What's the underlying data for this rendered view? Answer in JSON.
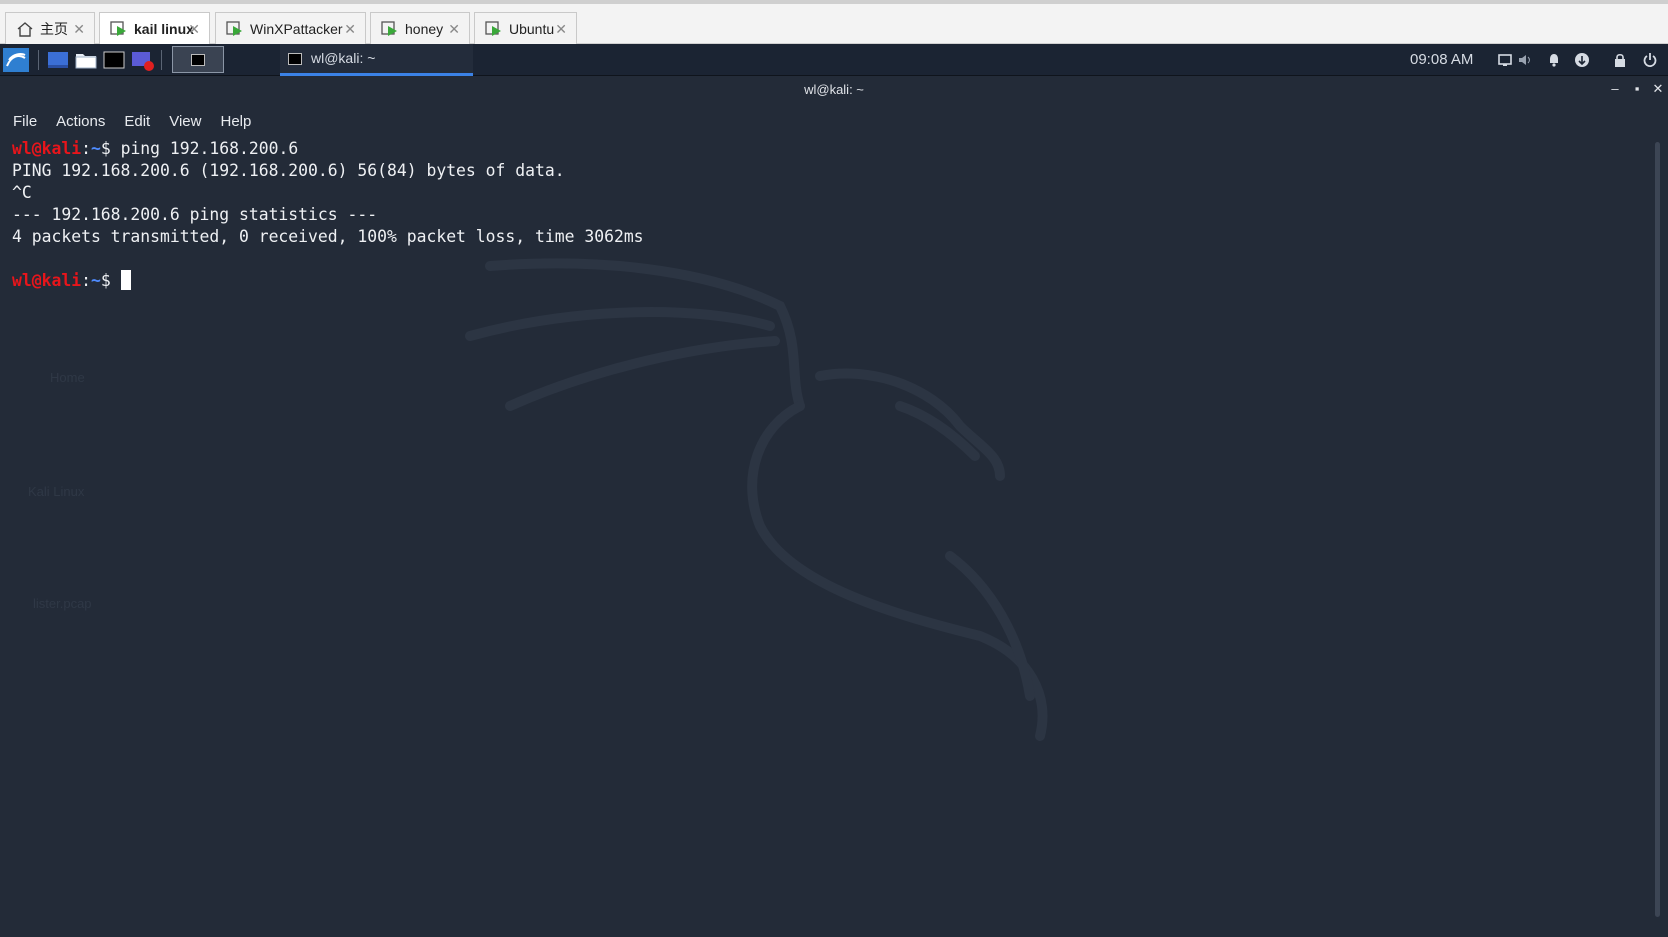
{
  "vm_tabs": [
    {
      "label": "主页",
      "icon": "home-icon",
      "active": false
    },
    {
      "label": "kail linux",
      "icon": "vm-play-icon",
      "active": true
    },
    {
      "label": "WinXPattacker",
      "icon": "vm-play-icon",
      "active": false
    },
    {
      "label": "honey",
      "icon": "vm-play-icon",
      "active": false
    },
    {
      "label": "Ubuntu",
      "icon": "vm-play-icon",
      "active": false
    }
  ],
  "panel": {
    "task_label": "wl@kali: ~",
    "clock": "09:08 AM"
  },
  "window": {
    "title": "wl@kali: ~"
  },
  "menu": {
    "file": "File",
    "actions": "Actions",
    "edit": "Edit",
    "view": "View",
    "help": "Help"
  },
  "terminal": {
    "prompt_user": "wl@kali",
    "prompt_sep": ":",
    "prompt_path": "~",
    "prompt_dollar": "$",
    "command": " ping 192.168.200.6",
    "out_line1": "PING 192.168.200.6 (192.168.200.6) 56(84) bytes of data.",
    "out_line2": "^C",
    "out_line3": "--- 192.168.200.6 ping statistics ---",
    "out_line4": "4 packets transmitted, 0 received, 100% packet loss, time 3062ms"
  },
  "desktop_ghosts": {
    "home": "Home",
    "kali": "Kali Linux",
    "pcap": "lister.pcap"
  },
  "colors": {
    "terminal_bg": "#232b38",
    "prompt_user": "#e8151b",
    "prompt_path": "#4f8cff",
    "panel_bg": "#1b2433"
  }
}
